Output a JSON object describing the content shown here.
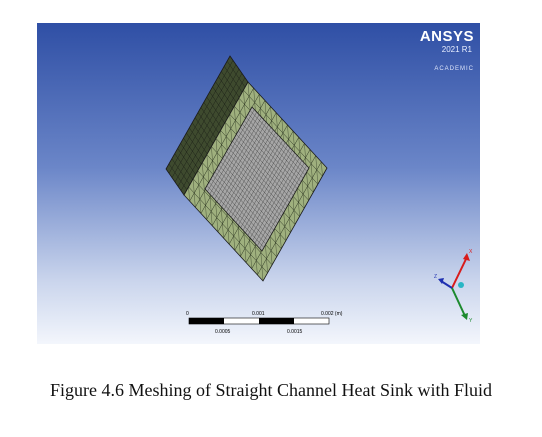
{
  "logo": {
    "brand": "ANSYS",
    "version": "2021 R1",
    "edition": "ACADEMIC"
  },
  "scale_bar": {
    "labels_top": [
      "0",
      "0.001",
      "0.002 (m)"
    ],
    "labels_bottom": [
      "0.0005",
      "0.0015"
    ]
  },
  "triad": {
    "x_label": "X",
    "y_label": "Y",
    "z_label": "Z"
  },
  "colors": {
    "background_top": "#2f4fa5",
    "background_bottom": "#f3f6fc",
    "solid_mesh": "#9fb07e",
    "fluid_mesh": "#a6a6a6",
    "mesh_lines": "#2b2b2b",
    "triad_x": "#d81b1b",
    "triad_y": "#1c8a2e",
    "triad_z": "#1e2fb0"
  },
  "caption": "Figure 4.6 Meshing of Straight Channel Heat Sink with Fluid"
}
